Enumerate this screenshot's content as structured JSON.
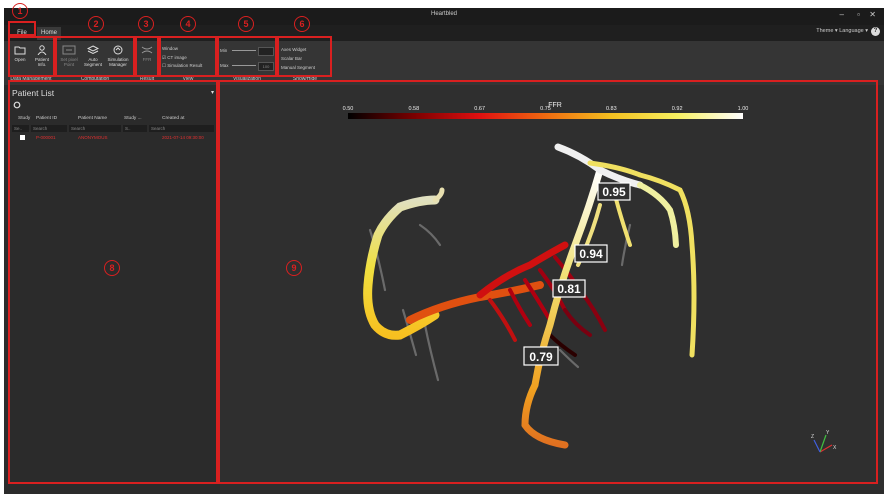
{
  "window": {
    "title": "Heartbled"
  },
  "tabs": [
    {
      "label": "File"
    },
    {
      "label": "Home"
    }
  ],
  "top_right": {
    "theme": "Theme",
    "language": "Language"
  },
  "ribbon": {
    "data_management": {
      "label": "Data Management",
      "open": "Open",
      "patient_info": "Patient Info."
    },
    "computation": {
      "label": "Computation",
      "set_pixel": "Set pixel Point",
      "auto_segment": "Auto Segment",
      "simulation_manager": "Simulation Manager"
    },
    "result": {
      "label": "Result",
      "ffr": "FFR"
    },
    "view": {
      "label": "View",
      "window": "Window",
      "ct_image": "CT image",
      "simulation_result": "Simulation Result"
    },
    "visualization": {
      "label": "Visualization",
      "min": "Min",
      "max": "Max",
      "max_value": "100"
    },
    "show_hide": {
      "label": "Show/Hide",
      "axes_widget": "Axes Widget",
      "scalar_bar": "Scalar Bar",
      "manual_segment": "Manual Segment"
    }
  },
  "annotations": [
    "1",
    "2",
    "3",
    "4",
    "5",
    "6",
    "8",
    "9"
  ],
  "patient_list": {
    "title": "Patient List",
    "columns": [
      "Study",
      "Patient ID",
      "Patient Name",
      "Study ...",
      "Created at"
    ],
    "search_placeholder": "Search",
    "rows": [
      {
        "patient_id": "P-000001",
        "patient_name": "ANONYMOUS",
        "created_at": "2021-07-14 09:30:00"
      }
    ]
  },
  "colorbar": {
    "title": "FFR",
    "ticks": [
      "0.50",
      "0.58",
      "0.67",
      "0.75",
      "0.83",
      "0.92",
      "1.00"
    ],
    "stops": [
      "#000000",
      "#7a0000",
      "#e01010",
      "#f06a10",
      "#f3c020",
      "#f7f060",
      "#ffffff"
    ]
  },
  "ffr_labels": [
    {
      "value": "0.95"
    },
    {
      "value": "0.94"
    },
    {
      "value": "0.81"
    },
    {
      "value": "0.79"
    }
  ],
  "axes": {
    "x": "X",
    "y": "Y",
    "z": "Z"
  },
  "colors": {
    "highlight_border": "#d92020",
    "background": "#2f2f2f"
  }
}
